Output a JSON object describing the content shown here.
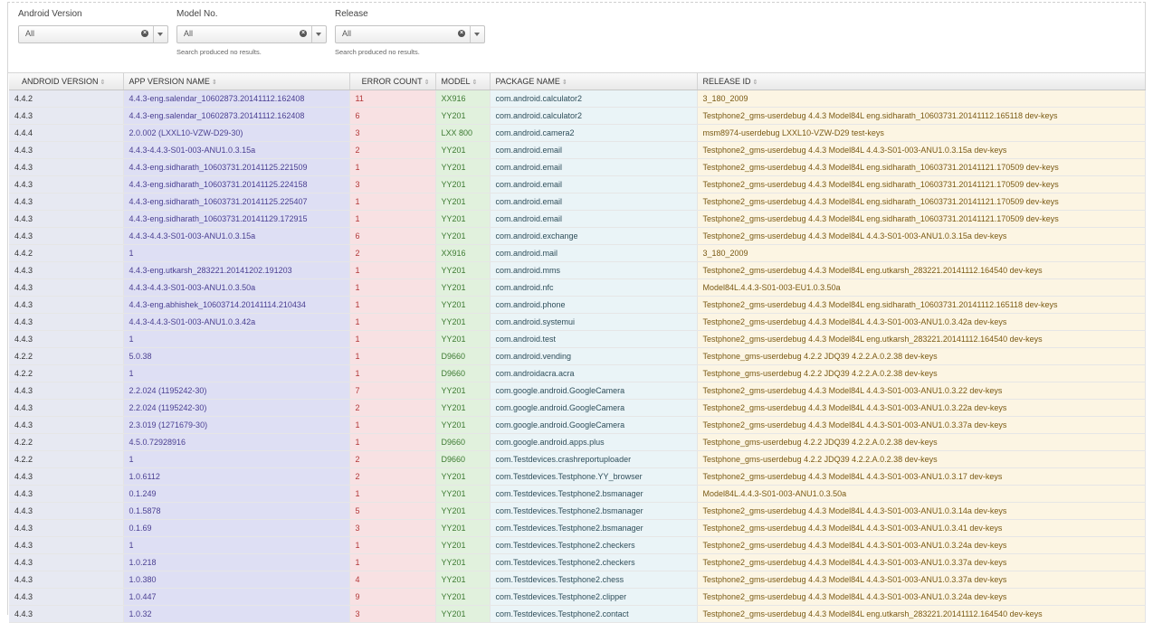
{
  "filters": [
    {
      "label": "Android Version",
      "value": "All",
      "note": ""
    },
    {
      "label": "Model No.",
      "value": "All",
      "note": "Search produced no results."
    },
    {
      "label": "Release",
      "value": "All",
      "note": "Search produced no results."
    }
  ],
  "table": {
    "columns": [
      "ANDROID VERSION",
      "APP VERSION NAME",
      "ERROR COUNT",
      "MODEL",
      "PACKAGE NAME",
      "RELEASE ID"
    ],
    "rows": [
      [
        "4.4.2",
        "4.4.3-eng.salendar_10602873.20141112.162408",
        "11",
        "XX916",
        "com.android.calculator2",
        "3_180_2009"
      ],
      [
        "4.4.3",
        "4.4.3-eng.salendar_10602873.20141112.162408",
        "6",
        "YY201",
        "com.android.calculator2",
        "Testphone2_gms-userdebug 4.4.3 Model84L eng.sidharath_10603731.20141112.165118 dev-keys"
      ],
      [
        "4.4.4",
        "2.0.002 (LXXL10-VZW-D29-30)",
        "3",
        "LXX 800",
        "com.android.camera2",
        "msm8974-userdebug LXXL10-VZW-D29 test-keys"
      ],
      [
        "4.4.3",
        "4.4.3-4.4.3-S01-003-ANU1.0.3.15a",
        "2",
        "YY201",
        "com.android.email",
        "Testphone2_gms-userdebug 4.4.3 Model84L 4.4.3-S01-003-ANU1.0.3.15a dev-keys"
      ],
      [
        "4.4.3",
        "4.4.3-eng.sidharath_10603731.20141125.221509",
        "1",
        "YY201",
        "com.android.email",
        "Testphone2_gms-userdebug 4.4.3 Model84L eng.sidharath_10603731.20141121.170509 dev-keys"
      ],
      [
        "4.4.3",
        "4.4.3-eng.sidharath_10603731.20141125.224158",
        "3",
        "YY201",
        "com.android.email",
        "Testphone2_gms-userdebug 4.4.3 Model84L eng.sidharath_10603731.20141121.170509 dev-keys"
      ],
      [
        "4.4.3",
        "4.4.3-eng.sidharath_10603731.20141125.225407",
        "1",
        "YY201",
        "com.android.email",
        "Testphone2_gms-userdebug 4.4.3 Model84L eng.sidharath_10603731.20141121.170509 dev-keys"
      ],
      [
        "4.4.3",
        "4.4.3-eng.sidharath_10603731.20141129.172915",
        "1",
        "YY201",
        "com.android.email",
        "Testphone2_gms-userdebug 4.4.3 Model84L eng.sidharath_10603731.20141121.170509 dev-keys"
      ],
      [
        "4.4.3",
        "4.4.3-4.4.3-S01-003-ANU1.0.3.15a",
        "6",
        "YY201",
        "com.android.exchange",
        "Testphone2_gms-userdebug 4.4.3 Model84L 4.4.3-S01-003-ANU1.0.3.15a dev-keys"
      ],
      [
        "4.4.2",
        "1",
        "2",
        "XX916",
        "com.android.mail",
        "3_180_2009"
      ],
      [
        "4.4.3",
        "4.4.3-eng.utkarsh_283221.20141202.191203",
        "1",
        "YY201",
        "com.android.mms",
        "Testphone2_gms-userdebug 4.4.3 Model84L eng.utkarsh_283221.20141112.164540 dev-keys"
      ],
      [
        "4.4.3",
        "4.4.3-4.4.3-S01-003-ANU1.0.3.50a",
        "1",
        "YY201",
        "com.android.nfc",
        "Model84L.4.4.3-S01-003-EU1.0.3.50a"
      ],
      [
        "4.4.3",
        "4.4.3-eng.abhishek_10603714.20141114.210434",
        "1",
        "YY201",
        "com.android.phone",
        "Testphone2_gms-userdebug 4.4.3 Model84L eng.sidharath_10603731.20141112.165118 dev-keys"
      ],
      [
        "4.4.3",
        "4.4.3-4.4.3-S01-003-ANU1.0.3.42a",
        "1",
        "YY201",
        "com.android.systemui",
        "Testphone2_gms-userdebug 4.4.3 Model84L 4.4.3-S01-003-ANU1.0.3.42a dev-keys"
      ],
      [
        "4.4.3",
        "1",
        "1",
        "YY201",
        "com.android.test",
        "Testphone2_gms-userdebug 4.4.3 Model84L eng.utkarsh_283221.20141112.164540 dev-keys"
      ],
      [
        "4.2.2",
        "5.0.38",
        "1",
        "D9660",
        "com.android.vending",
        "Testphone_gms-userdebug 4.2.2 JDQ39 4.2.2.A.0.2.38 dev-keys"
      ],
      [
        "4.2.2",
        "1",
        "1",
        "D9660",
        "com.androidacra.acra",
        "Testphone_gms-userdebug 4.2.2 JDQ39 4.2.2.A.0.2.38 dev-keys"
      ],
      [
        "4.4.3",
        "2.2.024 (1195242-30)",
        "7",
        "YY201",
        "com.google.android.GoogleCamera",
        "Testphone2_gms-userdebug 4.4.3 Model84L 4.4.3-S01-003-ANU1.0.3.22 dev-keys"
      ],
      [
        "4.4.3",
        "2.2.024 (1195242-30)",
        "2",
        "YY201",
        "com.google.android.GoogleCamera",
        "Testphone2_gms-userdebug 4.4.3 Model84L 4.4.3-S01-003-ANU1.0.3.22a dev-keys"
      ],
      [
        "4.4.3",
        "2.3.019 (1271679-30)",
        "1",
        "YY201",
        "com.google.android.GoogleCamera",
        "Testphone2_gms-userdebug 4.4.3 Model84L 4.4.3-S01-003-ANU1.0.3.37a dev-keys"
      ],
      [
        "4.2.2",
        "4.5.0.72928916",
        "1",
        "D9660",
        "com.google.android.apps.plus",
        "Testphone_gms-userdebug 4.2.2 JDQ39 4.2.2.A.0.2.38 dev-keys"
      ],
      [
        "4.2.2",
        "1",
        "2",
        "D9660",
        "com.Testdevices.crashreportuploader",
        "Testphone_gms-userdebug 4.2.2 JDQ39 4.2.2.A.0.2.38 dev-keys"
      ],
      [
        "4.4.3",
        "1.0.6112",
        "2",
        "YY201",
        "com.Testdevices.Testphone.YY_browser",
        "Testphone2_gms-userdebug 4.4.3 Model84L 4.4.3-S01-003-ANU1.0.3.17 dev-keys"
      ],
      [
        "4.4.3",
        "0.1.249",
        "1",
        "YY201",
        "com.Testdevices.Testphone2.bsmanager",
        "Model84L.4.4.3-S01-003-ANU1.0.3.50a"
      ],
      [
        "4.4.3",
        "0.1.5878",
        "5",
        "YY201",
        "com.Testdevices.Testphone2.bsmanager",
        "Testphone2_gms-userdebug 4.4.3 Model84L 4.4.3-S01-003-ANU1.0.3.14a dev-keys"
      ],
      [
        "4.4.3",
        "0.1.69",
        "3",
        "YY201",
        "com.Testdevices.Testphone2.bsmanager",
        "Testphone2_gms-userdebug 4.4.3 Model84L 4.4.3-S01-003-ANU1.0.3.41 dev-keys"
      ],
      [
        "4.4.3",
        "1",
        "1",
        "YY201",
        "com.Testdevices.Testphone2.checkers",
        "Testphone2_gms-userdebug 4.4.3 Model84L 4.4.3-S01-003-ANU1.0.3.24a dev-keys"
      ],
      [
        "4.4.3",
        "1.0.218",
        "1",
        "YY201",
        "com.Testdevices.Testphone2.checkers",
        "Testphone2_gms-userdebug 4.4.3 Model84L 4.4.3-S01-003-ANU1.0.3.37a dev-keys"
      ],
      [
        "4.4.3",
        "1.0.380",
        "4",
        "YY201",
        "com.Testdevices.Testphone2.chess",
        "Testphone2_gms-userdebug 4.4.3 Model84L 4.4.3-S01-003-ANU1.0.3.37a dev-keys"
      ],
      [
        "4.4.3",
        "1.0.447",
        "9",
        "YY201",
        "com.Testdevices.Testphone2.clipper",
        "Testphone2_gms-userdebug 4.4.3 Model84L 4.4.3-S01-003-ANU1.0.3.24a dev-keys"
      ],
      [
        "4.4.3",
        "1.0.32",
        "3",
        "YY201",
        "com.Testdevices.Testphone2.contact",
        "Testphone2_gms-userdebug 4.4.3 Model84L eng.utkarsh_283221.20141112.164540 dev-keys"
      ]
    ]
  }
}
